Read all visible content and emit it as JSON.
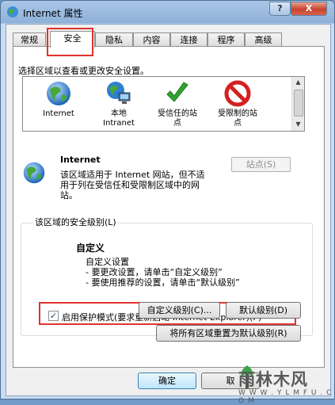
{
  "window": {
    "title": "Internet 属性",
    "help_label": "?",
    "close_label": "X"
  },
  "tabs": [
    "常规",
    "安全",
    "隐私",
    "内容",
    "连接",
    "程序",
    "高级"
  ],
  "instruction": "选择区域以查看或更改安全设置。",
  "zones": [
    {
      "icon": "internet-globe-icon",
      "label_lines": [
        "Internet"
      ]
    },
    {
      "icon": "local-intranet-icon",
      "label_lines": [
        "本地",
        "Intranet"
      ]
    },
    {
      "icon": "green-check-icon",
      "label_lines": [
        "受信任的站",
        "点"
      ]
    },
    {
      "icon": "restricted-icon",
      "label_lines": [
        "受限制的站",
        "点"
      ]
    }
  ],
  "selected_zone": {
    "name": "Internet",
    "description": "该区域适用于 Internet 网站，但不适用于列在受信任和受限制区域中的网站。",
    "sites_button": "站点(S)"
  },
  "security_level": {
    "group_label": "该区域的安全级别(L)",
    "title": "自定义",
    "lines": [
      "自定义设置",
      "- 要更改设置，请单击“自定义级别”",
      "- 要使用推荐的设置，请单击“默认级别”"
    ]
  },
  "protected_mode": {
    "checked": true,
    "check_glyph": "✓",
    "label": "启用保护模式(要求重新启动 Internet Explorer)(P)"
  },
  "buttons": {
    "custom_level": "自定义级别(C)...",
    "default_level": "默认级别(D)",
    "reset_all": "将所有区域重置为默认级别(R)",
    "ok": "确定",
    "cancel": "取"
  },
  "watermark": {
    "text": "雨林木风",
    "url": "W W W . Y L M F U . C O M"
  },
  "colors": {
    "highlight_red": "#e0322f",
    "check_green": "#2fa32f",
    "restricted_red": "#d42020"
  }
}
